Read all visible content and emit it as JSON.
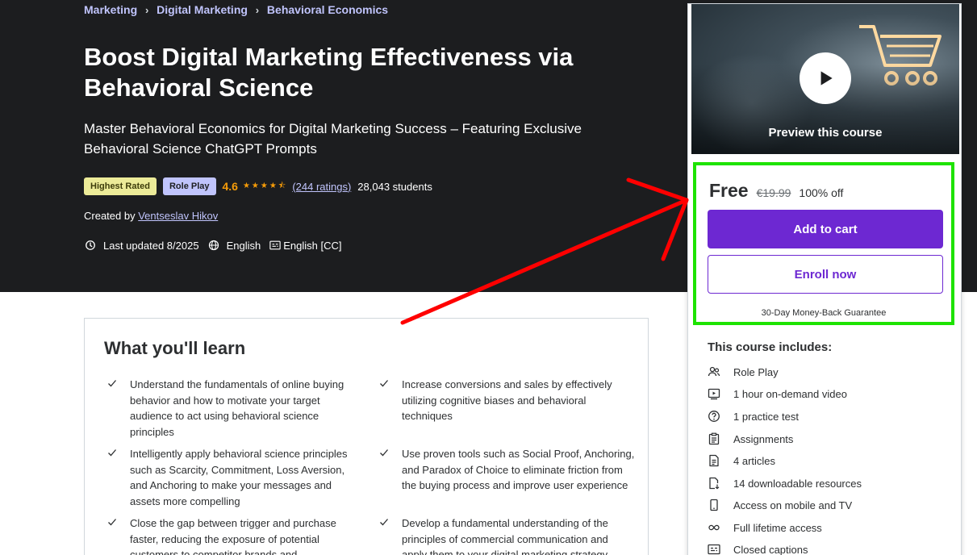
{
  "breadcrumb": [
    "Marketing",
    "Digital Marketing",
    "Behavioral Economics"
  ],
  "course": {
    "title": "Boost Digital Marketing Effectiveness via Behavioral Science",
    "subtitle": "Master Behavioral Economics for Digital Marketing Success – Featuring Exclusive Behavioral Science ChatGPT Prompts",
    "badge_highest": "Highest Rated",
    "badge_roleplay": "Role Play",
    "rating": "4.6",
    "stars": "★★★★⯪",
    "ratings_count": "(244 ratings)",
    "students": "28,043 students",
    "created_by_label": "Created by",
    "instructor": "Ventseslav Hikov",
    "last_updated": "Last updated 8/2025",
    "language": "English",
    "captions": "English [CC]"
  },
  "learn": {
    "title": "What you'll learn",
    "items": [
      "Understand the fundamentals of online buying behavior and how to motivate your target audience to act using behavioral science principles",
      "Increase conversions and sales by effectively utilizing cognitive biases and behavioral techniques",
      "Intelligently apply behavioral science principles such as Scarcity, Commitment, Loss Aversion, and Anchoring to make your messages and assets more compelling",
      "Use proven tools such as Social Proof, Anchoring, and Paradox of Choice to eliminate friction from the buying process and improve user experience",
      "Close the gap between trigger and purchase faster, reducing the exposure of potential customers to competitor brands and",
      "Develop a fundamental understanding of the principles of commercial communication and apply them to your digital marketing strategy"
    ]
  },
  "sidebar": {
    "preview_label": "Preview this course",
    "price_free": "Free",
    "price_original": "€19.99",
    "discount": "100% off",
    "add_to_cart": "Add to cart",
    "enroll_now": "Enroll now",
    "guarantee": "30-Day Money-Back Guarantee",
    "includes_title": "This course includes:",
    "includes": [
      {
        "icon": "users-icon",
        "label": "Role Play"
      },
      {
        "icon": "video-icon",
        "label": "1 hour on-demand video"
      },
      {
        "icon": "question-icon",
        "label": "1 practice test"
      },
      {
        "icon": "clipboard-icon",
        "label": "Assignments"
      },
      {
        "icon": "article-icon",
        "label": "4 articles"
      },
      {
        "icon": "download-icon",
        "label": "14 downloadable resources"
      },
      {
        "icon": "mobile-icon",
        "label": "Access on mobile and TV"
      },
      {
        "icon": "infinity-icon",
        "label": "Full lifetime access"
      },
      {
        "icon": "captions-icon",
        "label": "Closed captions"
      }
    ]
  },
  "colors": {
    "hero_bg": "#1c1d1f",
    "accent_purple": "#6d28d2",
    "link_lavender": "#c0c4fc",
    "rating_orange": "#f69c08",
    "highlight_green": "#1ee300",
    "annotation_red": "#ff0000"
  }
}
